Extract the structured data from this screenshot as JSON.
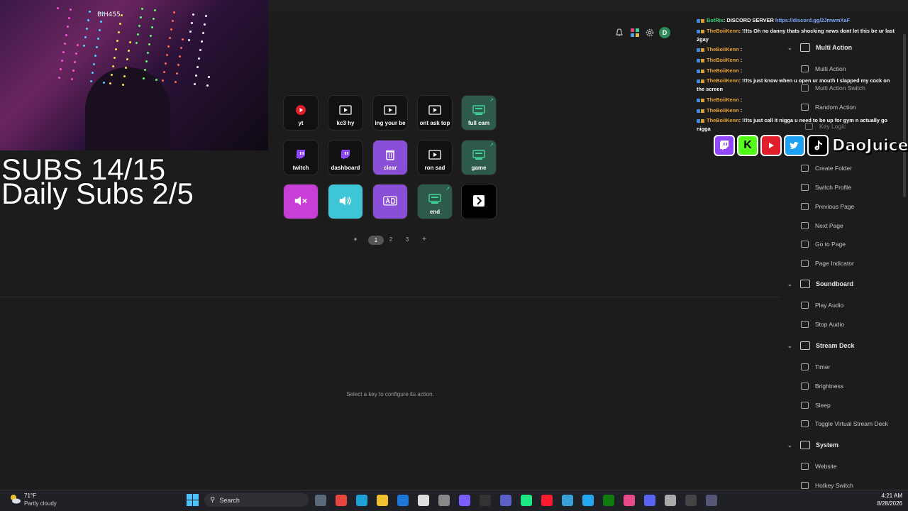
{
  "overlay": {
    "subs_line1": "SUBS 14/15",
    "subs_line2": "Daily Subs  2/5",
    "webcam_tag": "BIH455"
  },
  "header": {
    "avatar_letter": "D",
    "icons": [
      "bell-icon",
      "plugin-grid-icon",
      "gear-icon"
    ]
  },
  "keys": [
    {
      "label": "yt",
      "icon": "youtube-icon",
      "bg": "#111111",
      "accent": "#e01e2c"
    },
    {
      "label": "kc3 hy",
      "icon": "play-icon",
      "bg": "#111111",
      "accent": "#ffffff"
    },
    {
      "label": "ing your be",
      "icon": "play-icon",
      "bg": "#111111",
      "accent": "#ffffff"
    },
    {
      "label": "ont ask top",
      "icon": "play-icon",
      "bg": "#111111",
      "accent": "#ffffff"
    },
    {
      "label": "full cam",
      "icon": "scene-icon",
      "bg": "#2e5a4b",
      "accent": "#3fd39a"
    },
    {
      "label": "twitch",
      "icon": "twitch-icon",
      "bg": "#111111",
      "accent": "#9146ff"
    },
    {
      "label": "dashboard",
      "icon": "twitch-icon",
      "bg": "#111111",
      "accent": "#9146ff"
    },
    {
      "label": "clear",
      "icon": "trash-icon",
      "bg": "#8a4fd6",
      "accent": "#ffffff"
    },
    {
      "label": "ron sad",
      "icon": "play-icon",
      "bg": "#111111",
      "accent": "#ffffff"
    },
    {
      "label": "game",
      "icon": "scene-icon",
      "bg": "#2e5a4b",
      "accent": "#3fd39a"
    },
    {
      "label": "",
      "icon": "mute-icon",
      "bg": "#c83fd8",
      "accent": "#ffffff"
    },
    {
      "label": "",
      "icon": "volume-icon",
      "bg": "#3fc6d6",
      "accent": "#ffffff"
    },
    {
      "label": "",
      "icon": "ad-icon",
      "bg": "#8a4fd6",
      "accent": "#ffffff"
    },
    {
      "label": "end",
      "icon": "scene-icon",
      "bg": "#2e5a4b",
      "accent": "#3fd39a"
    },
    {
      "label": "",
      "icon": "next-icon",
      "bg": "#000000",
      "accent": "#ffffff"
    }
  ],
  "pager": {
    "pin": "✦",
    "pages": [
      "1",
      "2",
      "3"
    ],
    "add": "+",
    "active": "1"
  },
  "hint": "Select a key to configure its action.",
  "chat": [
    {
      "user": "BotRix",
      "text": ": DISCORD SERVER ",
      "link": "https://discord.gg/2JmwmXaF",
      "color": "#2fd47a"
    },
    {
      "user": "TheBoiiKenn",
      "text": ": !!!ts Oh no danny thats shocking news dont let this be ur last",
      "color": "#e5a52e"
    },
    {
      "user": "",
      "text": "2gay",
      "color": "#e5a52e"
    },
    {
      "user": "TheBoiiKenn",
      "text": " :",
      "color": "#e5a52e"
    },
    {
      "user": "TheBoiiKenn",
      "text": " :",
      "color": "#e5a52e"
    },
    {
      "user": "TheBoiiKenn",
      "text": " :",
      "color": "#e5a52e"
    },
    {
      "user": "TheBoiiKenn",
      "text": ": !!!ts just know when u open ur mouth I slapped my cock on",
      "color": "#e5a52e"
    },
    {
      "user": "",
      "text": "the screen",
      "color": "#e5a52e"
    },
    {
      "user": "TheBoiiKenn",
      "text": " :",
      "color": "#e5a52e"
    },
    {
      "user": "TheBoiiKenn",
      "text": " :",
      "color": "#e5a52e"
    },
    {
      "user": "TheBoiiKenn",
      "text": ": !!!ts just call it nigga u need to be up for gym n actually go",
      "color": "#e5a52e"
    },
    {
      "user": "",
      "text": "nigga",
      "color": "#e5a52e"
    }
  ],
  "social": {
    "brand": "DaoJuice",
    "icons": [
      "twitch-icon",
      "kick-icon",
      "youtube-icon",
      "twitter-icon",
      "tiktok-icon"
    ]
  },
  "panel": {
    "sections": [
      {
        "title": "Multi Action",
        "icon": "multi-action-icon",
        "items": [
          "Multi Action",
          "Multi Action Switch",
          "Random Action",
          "Key Logic"
        ]
      },
      {
        "title": "",
        "icon": "",
        "items": [
          "Create Folder",
          "Switch Profile",
          "Previous Page",
          "Next Page",
          "Go to Page",
          "Page Indicator"
        ]
      },
      {
        "title": "Soundboard",
        "icon": "speaker-icon",
        "items": [
          "Play Audio",
          "Stop Audio"
        ]
      },
      {
        "title": "Stream Deck",
        "icon": "grid-icon",
        "items": [
          "Timer",
          "Brightness",
          "Sleep",
          "Toggle Virtual Stream Deck"
        ]
      },
      {
        "title": "System",
        "icon": "computer-icon",
        "items": [
          "Website",
          "Hotkey Switch"
        ]
      }
    ]
  },
  "taskbar": {
    "weather_temp": "71°F",
    "weather_desc": "Partly cloudy",
    "search_label": "Search",
    "time": "4:21 AM",
    "date": "8/28/2026"
  }
}
